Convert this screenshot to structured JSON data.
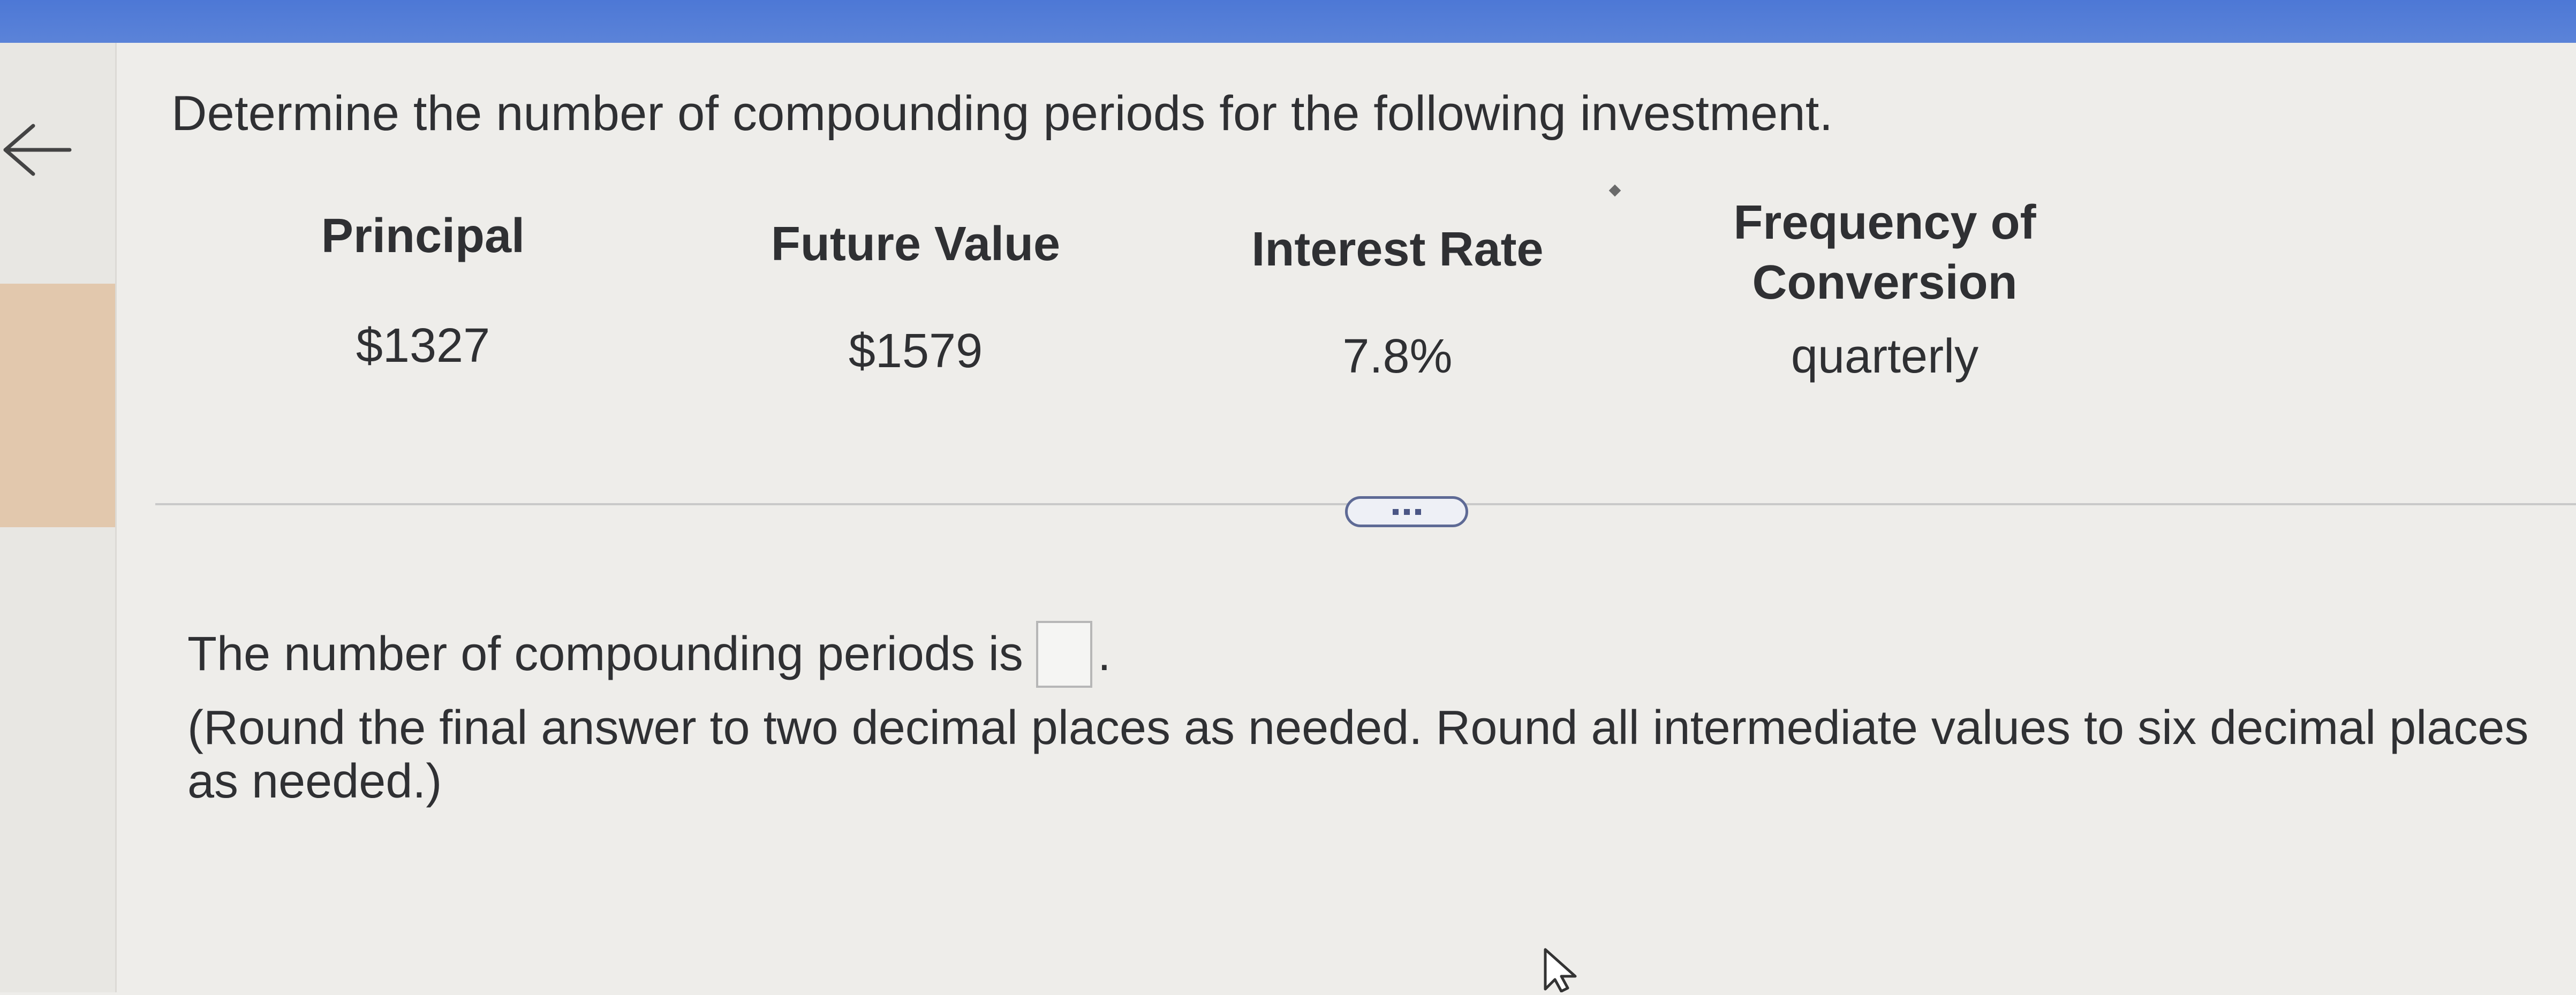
{
  "question": {
    "title": "Determine the number of compounding periods for the following investment."
  },
  "table": {
    "headers": [
      {
        "label": "Principal"
      },
      {
        "label": "Future Value"
      },
      {
        "label": "Interest Rate"
      },
      {
        "label": "Frequency of Conversion",
        "line1": "Frequency of",
        "line2": "Conversion"
      }
    ],
    "values": [
      "$1327",
      "$1579",
      "7.8%",
      "quarterly"
    ]
  },
  "answer": {
    "prompt": "The number of compounding periods is",
    "input_value": "",
    "period": "."
  },
  "instructions": {
    "text": "(Round the final answer to two decimal places as needed. Round all intermediate values to six decimal places as needed.)"
  },
  "icons": {
    "back": "back-arrow-icon",
    "more": "ellipsis-icon",
    "cursor": "mouse-pointer-icon"
  },
  "colors": {
    "topbar": "#4d78d6",
    "left_tab": "#e2c8ad",
    "background": "#eeedea",
    "more_button_border": "#5e6a95"
  }
}
